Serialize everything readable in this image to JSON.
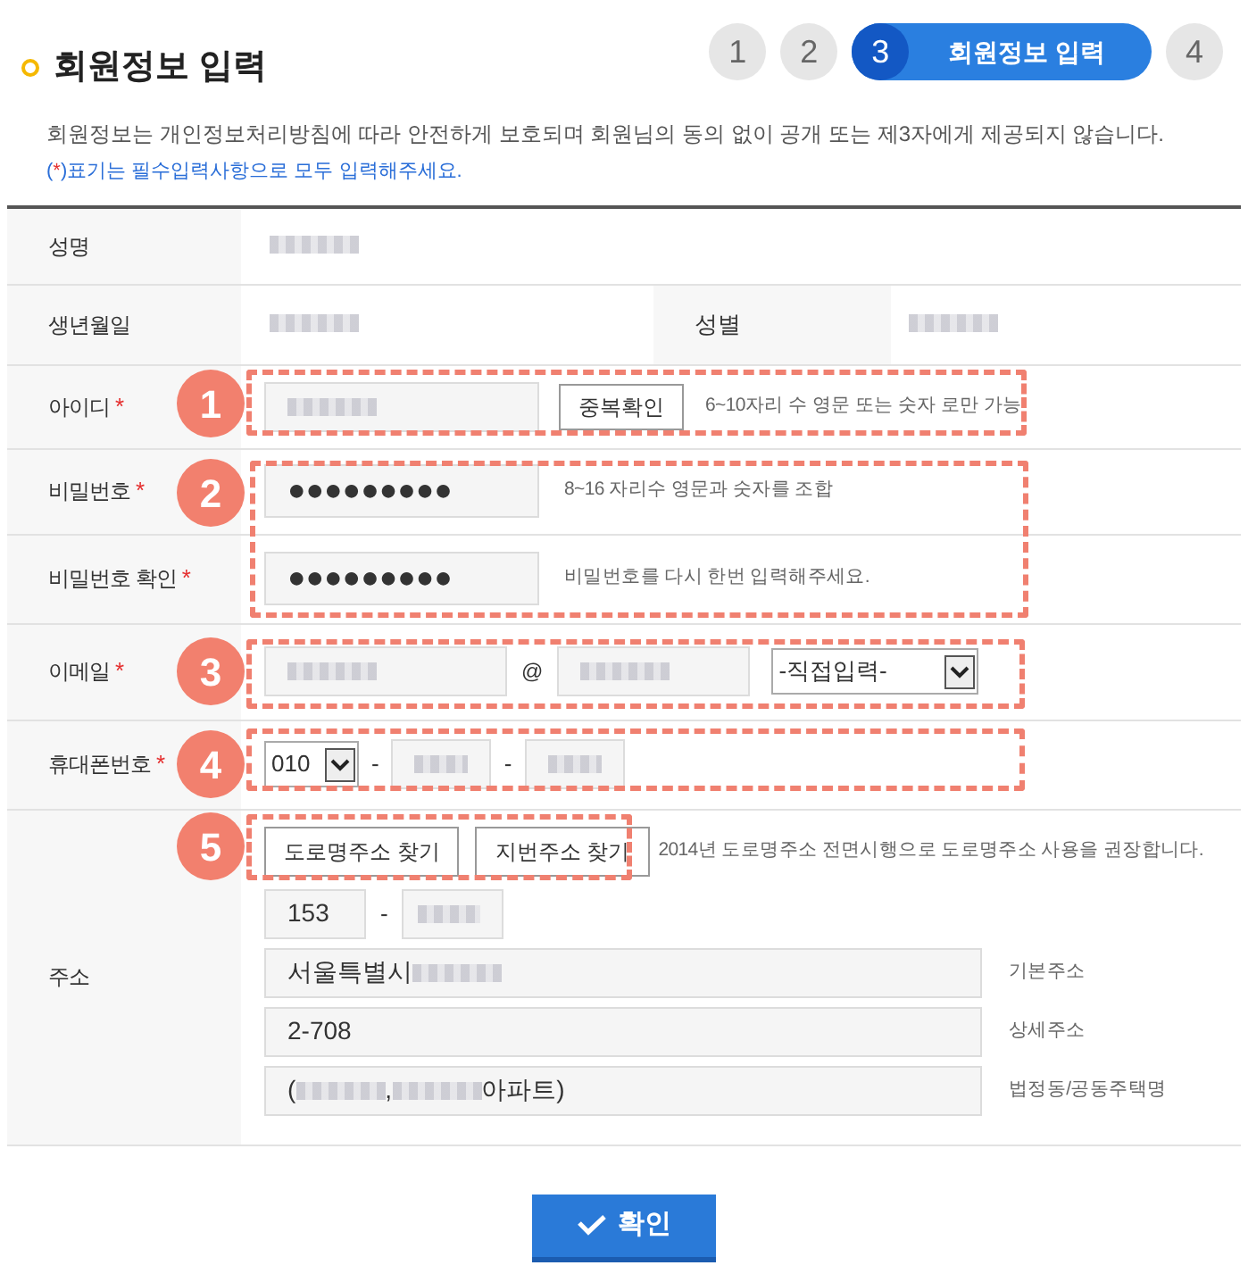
{
  "header": {
    "title": "회원정보 입력",
    "steps": [
      {
        "number": "1",
        "selected": false
      },
      {
        "number": "2",
        "selected": false
      },
      {
        "number": "3",
        "label": "회원정보 입력",
        "selected": true
      },
      {
        "number": "4",
        "selected": false
      }
    ]
  },
  "notice": "회원정보는 개인정보처리방침에 따라 안전하게 보호되며 회원님의 동의 없이 공개 또는 제3자에게 제공되지 않습니다.",
  "required_note": "(*)표기는 필수입력사항으로 모두 입력해주세요.",
  "rows": [
    {
      "kind": "name",
      "label": "성명",
      "value": [
        {
          "redacted": true
        }
      ]
    },
    {
      "kind": "birth",
      "label": "생년월일",
      "value": [
        {
          "redacted": true
        }
      ],
      "label_2": "성별",
      "value_2": [
        {
          "redacted": true
        }
      ]
    },
    {
      "kind": "id",
      "label": "아이디",
      "required_mark": "*",
      "value": [
        {
          "redacted": true
        }
      ],
      "button": "중복확인",
      "hint": "6~10자리 수 영문 또는 숫자 로만 가능"
    },
    {
      "kind": "password",
      "label": "비밀번호",
      "required_mark": "*",
      "value": [
        {
          "text": "●●●●●●●●●"
        }
      ],
      "hint": "8~16 자리수 영문과 숫자를 조합"
    },
    {
      "kind": "password",
      "label": "비밀번호 확인",
      "required_mark": "*",
      "value": [
        {
          "text": "●●●●●●●●●"
        }
      ],
      "hint": "비밀번호를 다시 한번 입력해주세요."
    },
    {
      "kind": "email",
      "label": "이메일",
      "required_mark": "*",
      "value": [
        {
          "redacted": true
        }
      ],
      "at": "@",
      "value_2": [
        {
          "redacted": true
        }
      ],
      "select": "-직접입력-"
    },
    {
      "kind": "phone",
      "label": "휴대폰번호",
      "required_mark": "*",
      "select": "010",
      "separator": "-",
      "value": [
        {
          "redacted": true
        }
      ],
      "value_2": [
        {
          "redacted": true
        }
      ]
    },
    {
      "kind": "address",
      "label": "주소",
      "buttons": [
        "도로명주소 찾기",
        "지번주소 찾기"
      ],
      "hint": "2014년 도로명주소 전면시행으로 도로명주소 사용을 권장합니다.",
      "zip": [
        {
          "text": "153"
        }
      ],
      "separator": "-",
      "zip_2": [
        {
          "redacted": true
        }
      ],
      "lines": [
        {
          "value": [
            {
              "text": "서울특별시 "
            },
            {
              "redacted": true
            }
          ],
          "caption": "기본주소"
        },
        {
          "value": [
            {
              "text": "2-708"
            }
          ],
          "caption": "상세주소"
        },
        {
          "value": [
            {
              "text": "("
            },
            {
              "redacted": true
            },
            {
              "text": ", "
            },
            {
              "redacted": true
            },
            {
              "text": "아파트)"
            }
          ],
          "caption": "법정동/공동주택명"
        }
      ]
    }
  ],
  "callouts": [
    {
      "number": "1"
    },
    {
      "number": "2"
    },
    {
      "number": "3"
    },
    {
      "number": "4"
    },
    {
      "number": "5"
    }
  ],
  "submit": "확인"
}
